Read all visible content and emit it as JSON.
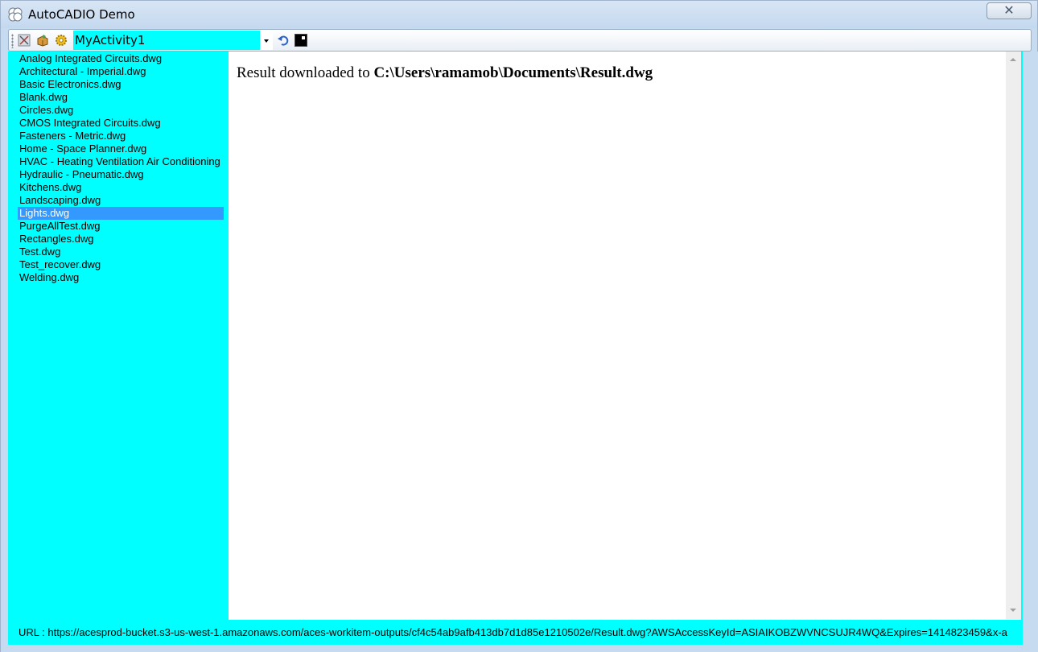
{
  "window": {
    "title": "AutoCADIO Demo",
    "close_label": "✕",
    "app_icon": "clover-icon"
  },
  "toolbar": {
    "icons": [
      "tools-icon",
      "package-icon",
      "gear-icon"
    ],
    "activity": "MyActivity1",
    "undo_icon": "undo-icon",
    "console_icon": "console-icon"
  },
  "files": [
    "Analog Integrated Circuits.dwg",
    "Architectural - Imperial.dwg",
    "Basic Electronics.dwg",
    "Blank.dwg",
    "Circles.dwg",
    "CMOS Integrated Circuits.dwg",
    "Fasteners - Metric.dwg",
    "Home - Space Planner.dwg",
    "HVAC - Heating Ventilation Air Conditioning",
    "Hydraulic - Pneumatic.dwg",
    "Kitchens.dwg",
    "Landscaping.dwg",
    "Lights.dwg",
    "PurgeAllTest.dwg",
    "Rectangles.dwg",
    "Test.dwg",
    "Test_recover.dwg",
    "Welding.dwg"
  ],
  "selected_file": "Lights.dwg",
  "result": {
    "prefix": "Result downloaded to ",
    "path": "C:\\Users\\ramamob\\Documents\\Result.dwg"
  },
  "status": {
    "url": "URL : https://acesprod-bucket.s3-us-west-1.amazonaws.com/aces-workitem-outputs/cf4c54ab9afb413db7d1d85e1210502e/Result.dwg?AWSAccessKeyId=ASIAIKOBZWVNCSUJR4WQ&Expires=1414823459&x-a"
  },
  "colors": {
    "panel": "#00ffff",
    "selection": "#3399ff",
    "frame": "#c6daf0"
  }
}
